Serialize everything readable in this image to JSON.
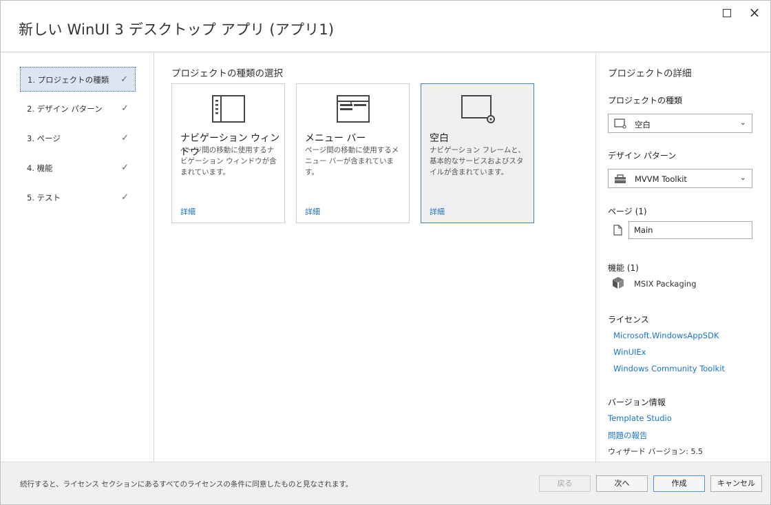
{
  "window": {
    "title": "新しい WinUI 3 デスクトップ アプリ (アプリ1)",
    "close_glyph": "×"
  },
  "steps": [
    {
      "label": "1. プロジェクトの種類",
      "check": "✓"
    },
    {
      "label": "2. デザイン パターン",
      "check": "✓"
    },
    {
      "label": "3. ページ",
      "check": "✓"
    },
    {
      "label": "4. 機能",
      "check": "✓"
    },
    {
      "label": "5. テスト",
      "check": "✓"
    }
  ],
  "main": {
    "section_title": "プロジェクトの種類の選択",
    "cards": [
      {
        "icon": "navigation-window-icon",
        "title": "ナビゲーション ウィンドウ",
        "desc": "ページ間の移動に使用するナビゲーション ウィンドウが含まれています。",
        "link": "詳細"
      },
      {
        "icon": "menu-bar-icon",
        "title": "メニュー バー",
        "desc": "ページ間の移動に使用するメニュー バーが含まれています。",
        "link": "詳細"
      },
      {
        "icon": "blank-window-icon",
        "title": "空白",
        "desc": "ナビゲーション フレームと、基本的なサービスおよびスタイルが含まれています。",
        "link": "詳細"
      }
    ]
  },
  "details": {
    "heading": "プロジェクトの詳細",
    "project_type_label": "プロジェクトの種類",
    "project_type_value": "空白",
    "design_pattern_label": "デザイン パターン",
    "design_pattern_value": "MVVM Toolkit",
    "pages_label": "ページ (1)",
    "page_value": "Main",
    "features_label": "機能 (1)",
    "feature_value": "MSIX Packaging",
    "license_label": "ライセンス",
    "licenses": [
      "Microsoft.WindowsAppSDK",
      "WinUIEx",
      "Windows Community Toolkit"
    ],
    "version_label": "バージョン情報",
    "template_studio_link": "Template Studio",
    "report_link": "問題の報告",
    "wizard_version": "ウィザード バージョン: 5.5"
  },
  "footer": {
    "notice": "続行すると、ライセンス セクションにあるすべてのライセンスの条件に同意したものと見なされます。",
    "back": "戻る",
    "next": "次へ",
    "create": "作成",
    "cancel": "キャンセル"
  },
  "colors": {
    "accent": "#1a73c7",
    "selected_step_bg": "#dde4f4",
    "selected_card_border": "#3b82c4"
  }
}
